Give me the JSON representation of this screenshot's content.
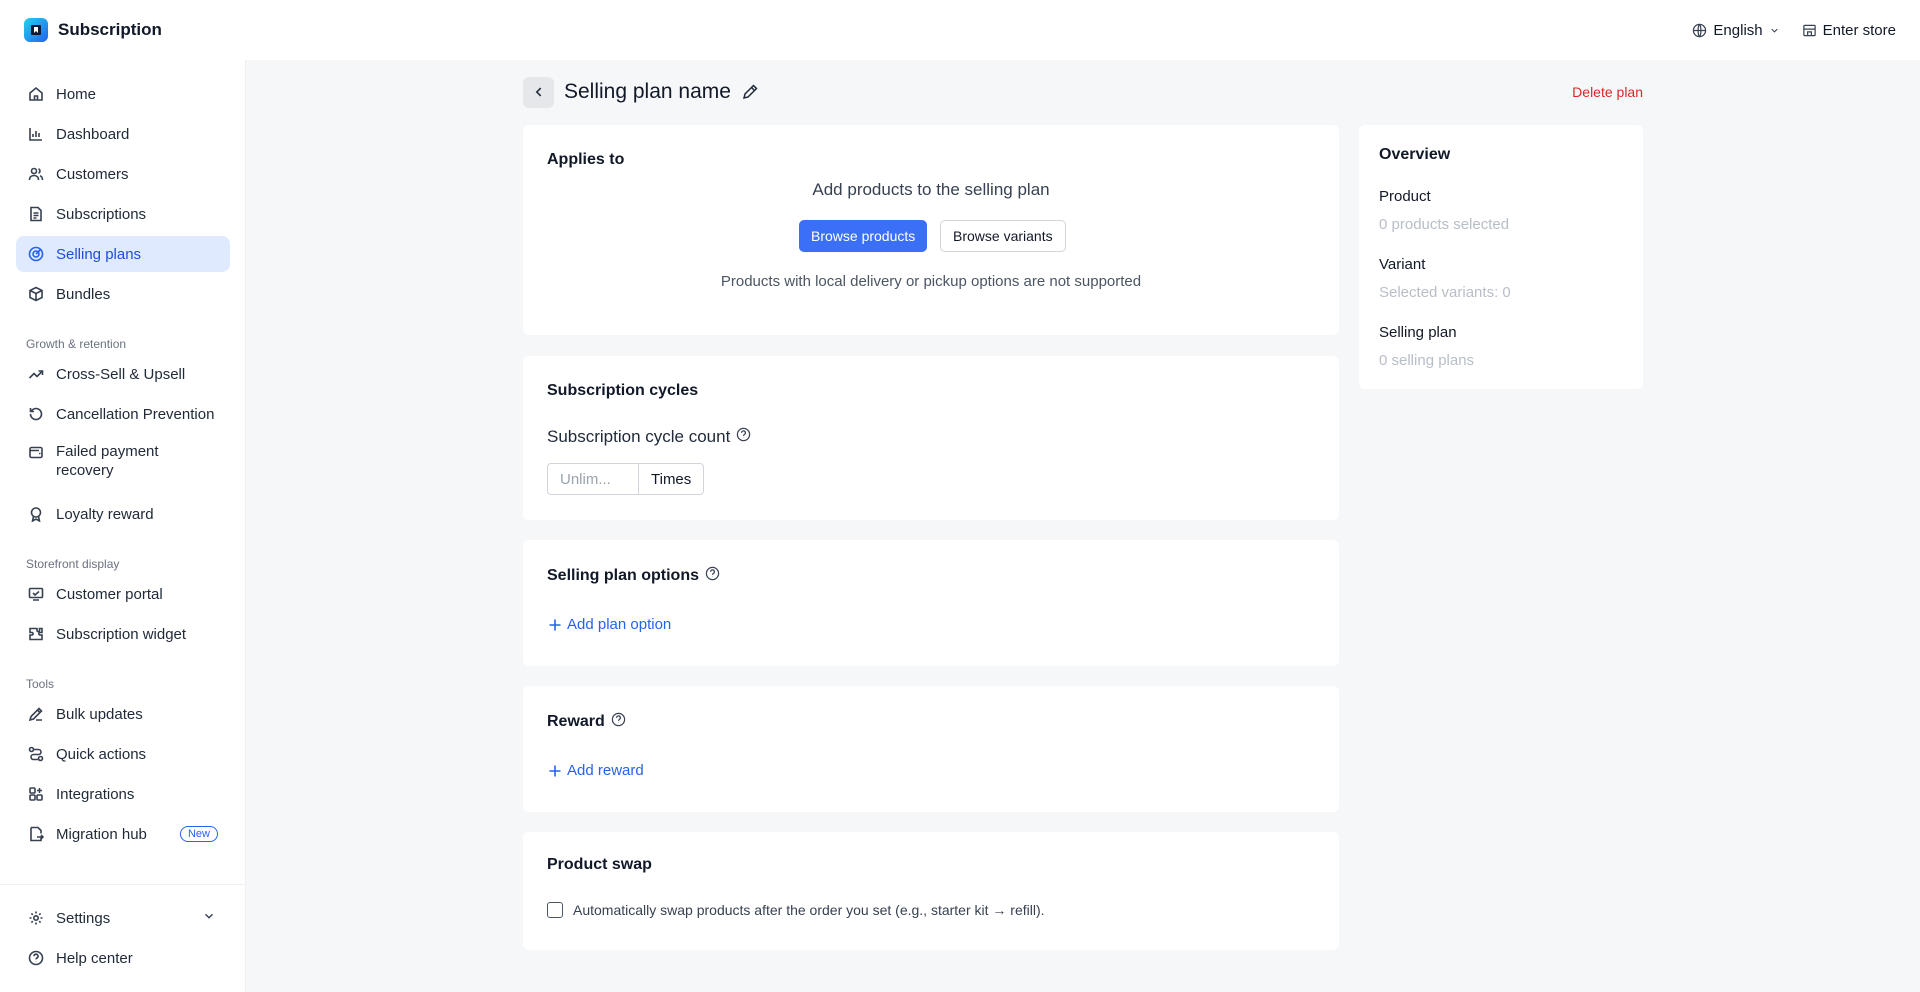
{
  "app": {
    "title": "Subscription"
  },
  "topbar": {
    "language": "English",
    "enter_store": "Enter store"
  },
  "sidebar": {
    "items": [
      {
        "label": "Home",
        "icon": "home-icon"
      },
      {
        "label": "Dashboard",
        "icon": "chart-icon"
      },
      {
        "label": "Customers",
        "icon": "users-icon"
      },
      {
        "label": "Subscriptions",
        "icon": "document-icon"
      },
      {
        "label": "Selling plans",
        "icon": "target-icon",
        "active": true
      },
      {
        "label": "Bundles",
        "icon": "box-icon"
      }
    ],
    "growth_label": "Growth & retention",
    "growth_items": [
      {
        "label": "Cross-Sell & Upsell",
        "icon": "trend-icon"
      },
      {
        "label": "Cancellation Prevention",
        "icon": "rotate-icon"
      },
      {
        "label": "Failed payment recovery",
        "icon": "wallet-icon"
      },
      {
        "label": "Loyalty reward",
        "icon": "award-icon"
      }
    ],
    "storefront_label": "Storefront display",
    "storefront_items": [
      {
        "label": "Customer portal",
        "icon": "monitor-icon"
      },
      {
        "label": "Subscription widget",
        "icon": "puzzle-icon"
      }
    ],
    "tools_label": "Tools",
    "tools_items": [
      {
        "label": "Bulk updates",
        "icon": "pen-icon"
      },
      {
        "label": "Quick actions",
        "icon": "route-icon"
      },
      {
        "label": "Integrations",
        "icon": "grid-icon"
      },
      {
        "label": "Migration hub",
        "icon": "migration-icon",
        "badge": "New"
      }
    ],
    "settings": "Settings",
    "help": "Help center"
  },
  "page": {
    "title": "Selling plan name",
    "delete": "Delete plan"
  },
  "applies_to": {
    "title": "Applies to",
    "heading": "Add products to the selling plan",
    "browse_products": "Browse products",
    "browse_variants": "Browse variants",
    "note": "Products with local delivery or pickup options are not supported"
  },
  "cycles": {
    "title": "Subscription cycles",
    "label": "Subscription cycle count",
    "placeholder": "Unlim...",
    "suffix": "Times"
  },
  "options": {
    "title": "Selling plan options",
    "add": "Add plan option"
  },
  "reward": {
    "title": "Reward",
    "add": "Add reward"
  },
  "swap": {
    "title": "Product swap",
    "checkbox_label": "Automatically swap products after the order you set (e.g., starter kit → refill).",
    "checked": false
  },
  "overview": {
    "title": "Overview",
    "product_label": "Product",
    "product_value": "0 products selected",
    "variant_label": "Variant",
    "variant_value": "Selected variants: 0",
    "plan_label": "Selling plan",
    "plan_value": "0 selling plans"
  },
  "colors": {
    "accent": "#3b6ff5",
    "danger": "#dc2626",
    "active_bg": "#e0eaff"
  }
}
